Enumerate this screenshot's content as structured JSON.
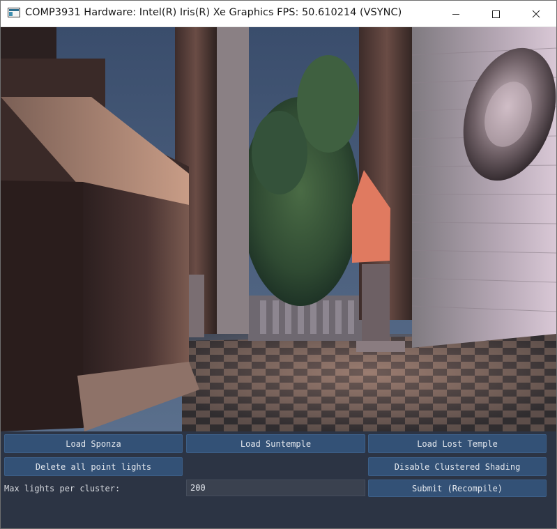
{
  "window": {
    "title": "COMP3931 Hardware: Intel(R) Iris(R) Xe Graphics FPS: 50.610214 (VSYNC)",
    "controls": [
      "minimize",
      "maximize",
      "close"
    ]
  },
  "viewport": {
    "scene_description_icon": "3d-render-viewport"
  },
  "panel": {
    "load_sponza_label": "Load Sponza",
    "load_suntemple_label": "Load Suntemple",
    "load_lost_temple_label": "Load Lost Temple",
    "delete_lights_label": "Delete all point lights",
    "disable_clustered_label": "Disable Clustered Shading",
    "max_lights_label": "Max lights per cluster:",
    "max_lights_value": "200",
    "submit_label": "Submit (Recompile)"
  },
  "colors": {
    "panel_bg": "#2c3444",
    "button_bg": "#335176",
    "input_bg": "#3a414f",
    "text": "#e4e8ee"
  }
}
